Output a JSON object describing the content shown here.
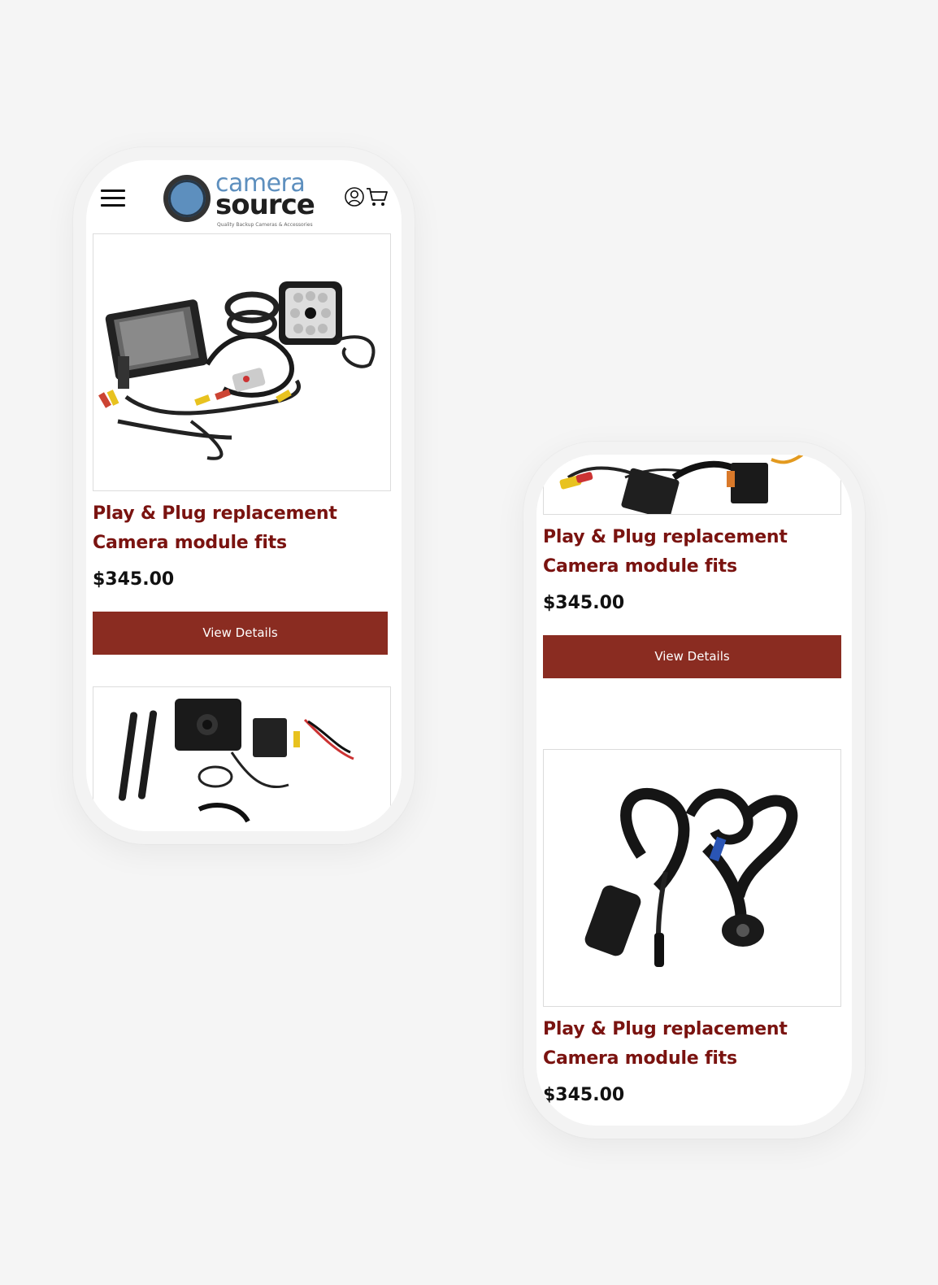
{
  "brand": {
    "name_top": "camera",
    "name_bottom": "source",
    "tagline": "Quality Backup Cameras & Accessories",
    "primary_color": "#8a2c21",
    "title_color": "#7a1310",
    "logo_blue": "#5d8fbe"
  },
  "header": {
    "menu_icon": "hamburger-icon",
    "account_icon": "user-icon",
    "cart_icon": "cart-icon"
  },
  "phone_a": {
    "products": [
      {
        "title": "Play & Plug replacement Camera module fits",
        "price": "$345.00",
        "button": "View Details",
        "image": "monitor-camera-kit-image"
      },
      {
        "image": "wireless-camera-kit-image"
      }
    ]
  },
  "phone_b": {
    "products": [
      {
        "title": "Play & Plug replacement Camera module fits",
        "price": "$345.00",
        "button": "View Details",
        "image": "harness-adapter-image"
      },
      {
        "title": "Play & Plug replacement Camera module fits",
        "price": "$345.00",
        "image": "camera-harness-image"
      }
    ]
  }
}
